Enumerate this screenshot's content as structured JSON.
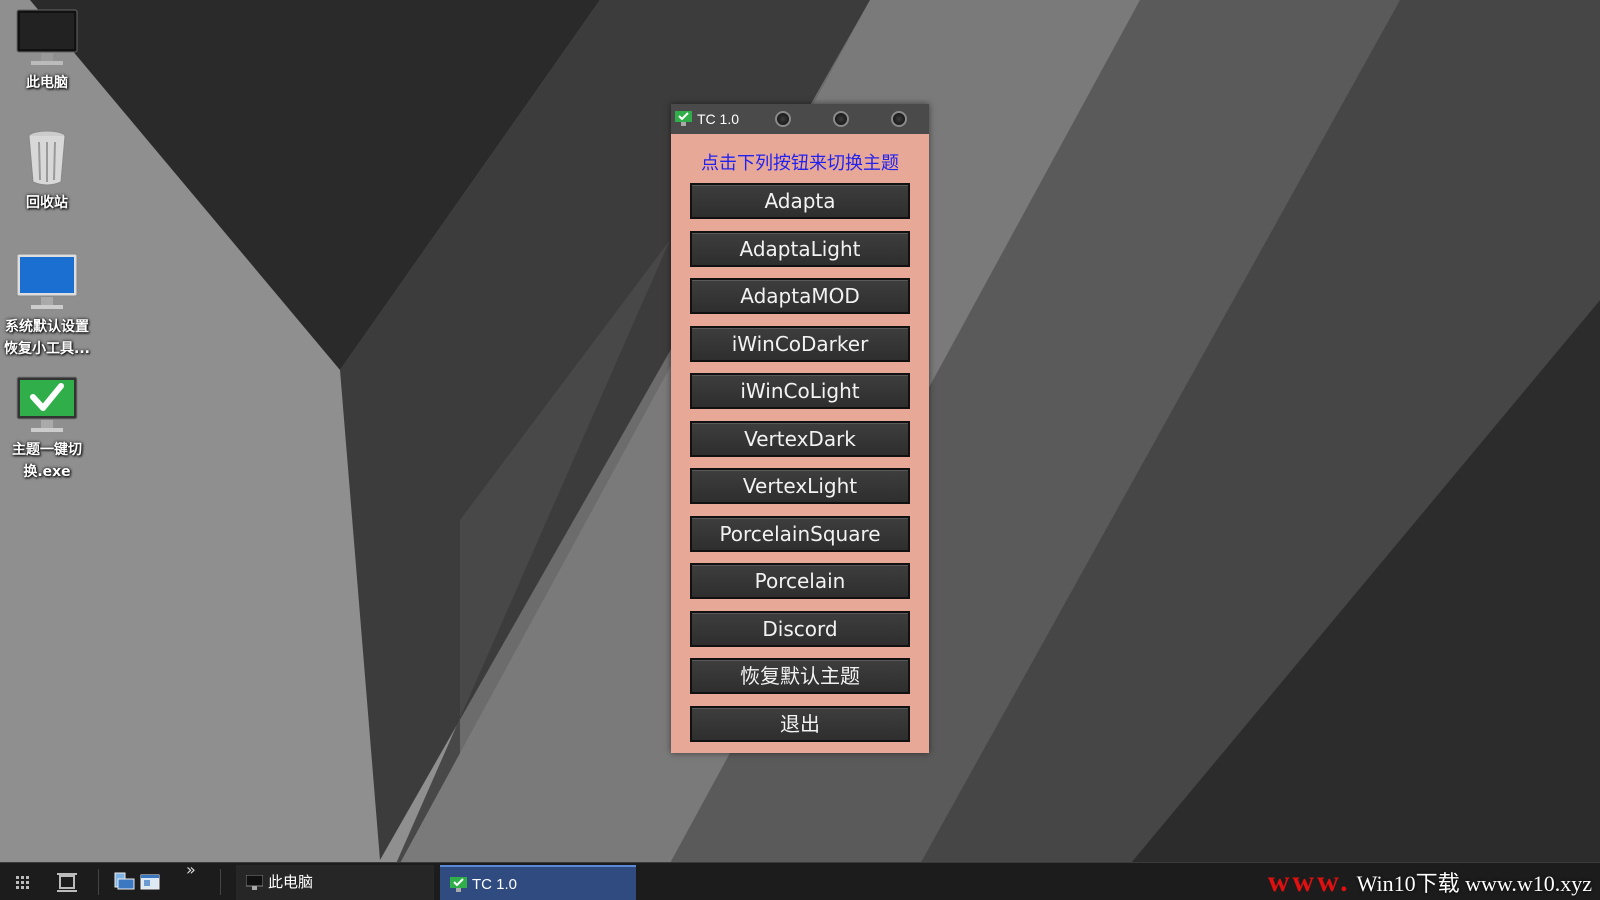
{
  "desktop": {
    "icons": [
      {
        "label": "此电脑",
        "icon": "monitor-dark-icon"
      },
      {
        "label": "回收站",
        "icon": "recycle-bin-icon"
      },
      {
        "label": "系统默认设置恢复小工具...",
        "icon": "monitor-blue-icon"
      },
      {
        "label": "主题一键切换.exe",
        "icon": "monitor-checkmark-icon"
      }
    ]
  },
  "window": {
    "title": "TC 1.0",
    "heading": "点击下列按钮来切换主题",
    "buttons": [
      "Adapta",
      "AdaptaLight",
      "AdaptaMOD",
      "iWinCoDarker",
      "iWinCoLight",
      "VertexDark",
      "VertexLight",
      "PorcelainSquare",
      "Porcelain",
      "Discord",
      "恢复默认主题",
      "退出"
    ],
    "heading_color": "#2222ee",
    "background_color": "#e8a898"
  },
  "taskbar": {
    "tasks": [
      {
        "label": "此电脑",
        "icon": "monitor-dark-icon",
        "active": false
      },
      {
        "label": "TC 1.0",
        "icon": "monitor-checkmark-icon",
        "active": true
      }
    ],
    "overflow": "»",
    "watermark_www": "www.",
    "watermark_text": "Win10下载 www.w10.xyz"
  }
}
